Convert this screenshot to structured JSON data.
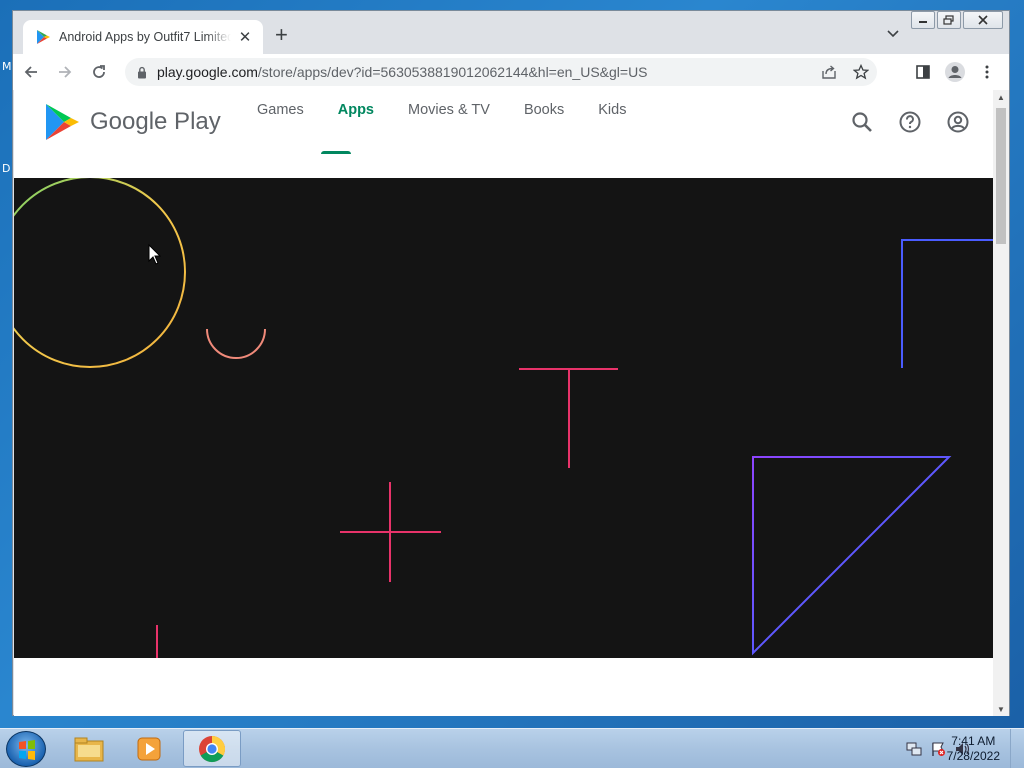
{
  "desktop": {
    "left_letters": [
      "M",
      "D"
    ]
  },
  "browser": {
    "tab_title": "Android Apps by Outfit7 Limited",
    "tab_close": "✕",
    "new_tab": "+",
    "url_host": "play.google.com",
    "url_path": "/store/apps/dev?id=5630538819012062144&hl=en_US&gl=US"
  },
  "gplay": {
    "logo_text": "Google Play",
    "nav": [
      {
        "label": "Games",
        "active": false
      },
      {
        "label": "Apps",
        "active": true
      },
      {
        "label": "Movies & TV",
        "active": false
      },
      {
        "label": "Books",
        "active": false
      },
      {
        "label": "Kids",
        "active": false
      }
    ],
    "accent_color": "#01875f",
    "hero_background": "#141414"
  },
  "taskbar": {
    "time": "7:41 AM",
    "date": "7/28/2022"
  }
}
